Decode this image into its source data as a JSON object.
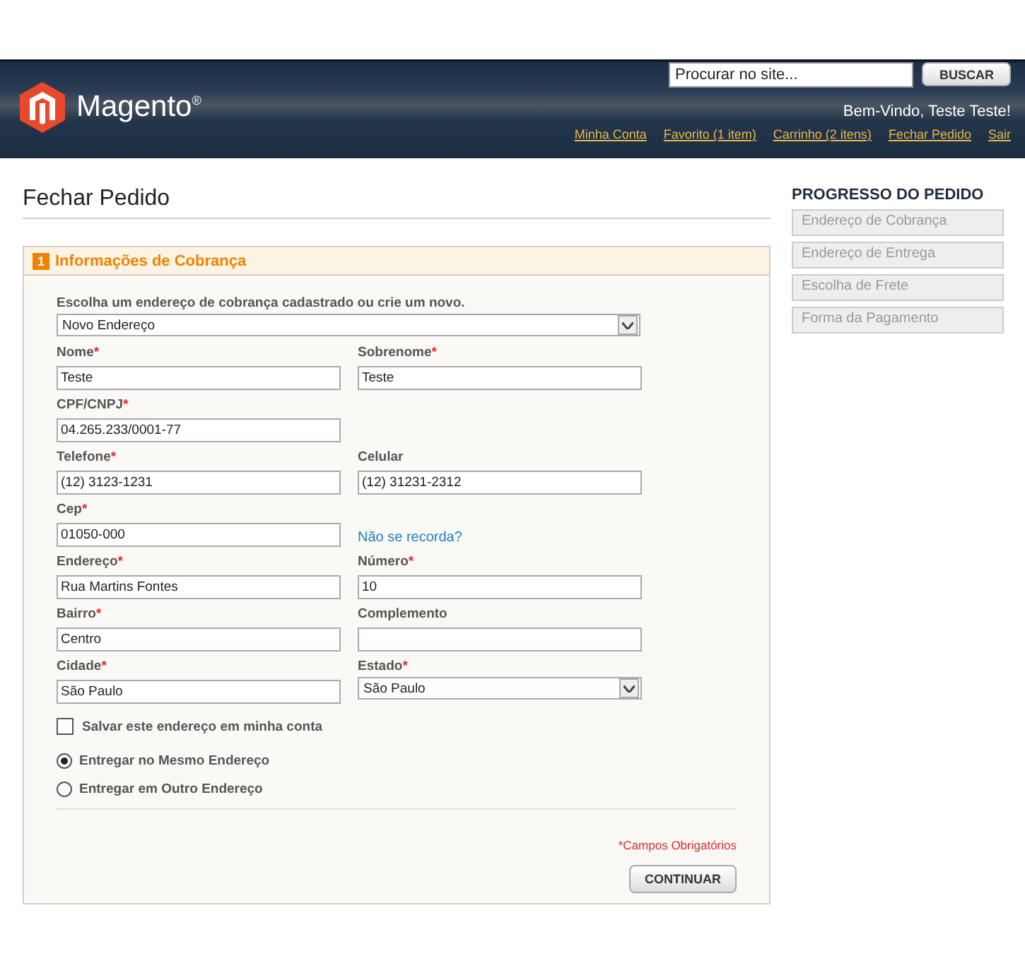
{
  "header": {
    "logo_text": "Magento$^{®}$",
    "search": {
      "placeholder": "Procurar no site...",
      "button": "BUSCAR"
    },
    "welcome": "Bem-Vindo, Teste Teste!",
    "links": [
      "Minha Conta",
      "Favorito (1 item)",
      "Carrinho (2 itens)",
      "Fechar Pedido",
      "Sair"
    ]
  },
  "page_title": "Fechar Pedido",
  "section": {
    "number": "1",
    "title": "Informações de Cobrança",
    "address_select": {
      "label": "Escolha um endereço de cobrança cadastrado ou crie um novo.",
      "value": "Novo Endereço"
    },
    "rows": [
      [
        {
          "kind": "text",
          "label": "Nome",
          "required_mark": "*",
          "value": "Teste"
        },
        {
          "kind": "text",
          "label": "Sobrenome",
          "required_mark": "*",
          "value": "Teste"
        }
      ],
      [
        {
          "kind": "text",
          "label": "CPF/CNPJ",
          "required_mark": "*",
          "value": "04.265.233/0001-77"
        }
      ],
      [
        {
          "kind": "text",
          "label": "Telefone",
          "required_mark": "*",
          "value": "(12) 3123-1231"
        },
        {
          "kind": "text",
          "label": "Celular",
          "value": "(12) 31231-2312"
        }
      ],
      [
        {
          "kind": "text",
          "label": "Cep",
          "required_mark": "*",
          "value": "01050-000"
        },
        {
          "kind": "link",
          "text": "Não se recorda?"
        }
      ],
      [
        {
          "kind": "text",
          "label": "Endereço",
          "required_mark": "*",
          "value": "Rua Martins Fontes"
        },
        {
          "kind": "text",
          "label": "Número",
          "required_mark": "*",
          "value": "10"
        }
      ],
      [
        {
          "kind": "text",
          "label": "Bairro",
          "required_mark": "*",
          "value": "Centro"
        },
        {
          "kind": "text",
          "label": "Complemento"
        }
      ],
      [
        {
          "kind": "text",
          "label": "Cidade",
          "required_mark": "*",
          "value": "São Paulo"
        },
        {
          "kind": "select",
          "label": "Estado",
          "required_mark": "*",
          "value": "São Paulo"
        }
      ]
    ],
    "save_checkbox": {
      "label": "Salvar este endereço em minha conta",
      "checked": false
    },
    "shipping_options": [
      {
        "label": "Entregar no Mesmo Endereço",
        "selected": true
      },
      {
        "label": "Entregar em Outro Endereço",
        "selected": false
      }
    ],
    "required_note": "*Campos Obrigatórios",
    "continue_button": "CONTINUAR"
  },
  "progress": {
    "title": "PROGRESSO DO PEDIDO",
    "steps": [
      "Endereço de Cobrança",
      "Endereço de Entrega",
      "Escolha de Frete",
      "Forma da Pagamento"
    ]
  }
}
